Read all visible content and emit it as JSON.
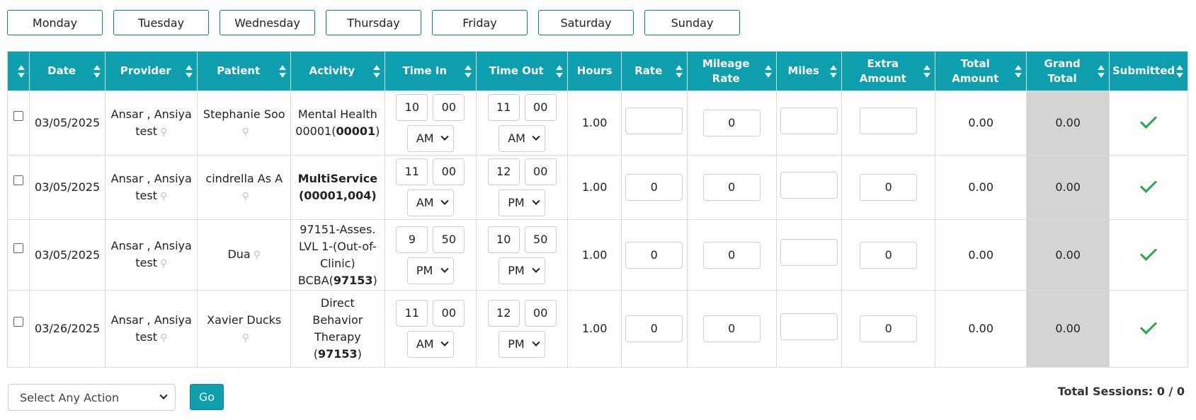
{
  "days": [
    "Monday",
    "Tuesday",
    "Wednesday",
    "Thursday",
    "Friday",
    "Saturday",
    "Sunday"
  ],
  "columns": {
    "date": "Date",
    "provider": "Provider",
    "patient": "Patient",
    "activity": "Activity",
    "time_in": "Time In",
    "time_out": "Time Out",
    "hours": "Hours",
    "rate": "Rate",
    "mileage_rate_1": "Mileage",
    "mileage_rate_2": "Rate",
    "miles": "Miles",
    "extra_amount_1": "Extra",
    "extra_amount_2": "Amount",
    "total_amount_1": "Total",
    "total_amount_2": "Amount",
    "grand_total_1": "Grand",
    "grand_total_2": "Total",
    "submitted": "Submitted"
  },
  "rows": [
    {
      "date": "03/05/2025",
      "provider_1": "Ansar , Ansiya",
      "provider_2": "test",
      "patient": "Stephanie Soo",
      "activity_1": "Mental Health",
      "activity_2": "00001(",
      "activity_code": "00001",
      "activity_3": ")",
      "time_in_hour": "10",
      "time_in_min": "00",
      "time_in_ampm": "AM",
      "time_out_hour": "11",
      "time_out_min": "00",
      "time_out_ampm": "AM",
      "hours": "1.00",
      "rate": "",
      "mileage_rate": "0",
      "miles": "",
      "extra_amount": "",
      "total_amount": "0.00",
      "grand_total": "0.00"
    },
    {
      "date": "03/05/2025",
      "provider_1": "Ansar , Ansiya",
      "provider_2": "test",
      "patient": "cindrella As A",
      "activity_1": "MultiService",
      "activity_2": "(00001,004)",
      "time_in_hour": "11",
      "time_in_min": "00",
      "time_in_ampm": "AM",
      "time_out_hour": "12",
      "time_out_min": "00",
      "time_out_ampm": "PM",
      "hours": "1.00",
      "rate": "0",
      "mileage_rate": "0",
      "miles": "",
      "extra_amount": "0",
      "total_amount": "0.00",
      "grand_total": "0.00"
    },
    {
      "date": "03/05/2025",
      "provider_1": "Ansar , Ansiya",
      "provider_2": "test",
      "patient": "Dua",
      "activity_1": "97151-Asses.",
      "activity_2": "LVL 1-(Out-of-",
      "activity_3": "Clinic)",
      "activity_4": "BCBA(",
      "activity_code": "97153",
      "activity_5": ")",
      "time_in_hour": "9",
      "time_in_min": "50",
      "time_in_ampm": "PM",
      "time_out_hour": "10",
      "time_out_min": "50",
      "time_out_ampm": "PM",
      "hours": "1.00",
      "rate": "0",
      "mileage_rate": "0",
      "miles": "",
      "extra_amount": "0",
      "total_amount": "0.00",
      "grand_total": "0.00"
    },
    {
      "date": "03/26/2025",
      "provider_1": "Ansar , Ansiya",
      "provider_2": "test",
      "patient": "Xavier Ducks",
      "activity_1": "Direct",
      "activity_2": "Behavior",
      "activity_3": "Therapy",
      "activity_4": "(",
      "activity_code": "97153",
      "activity_5": ")",
      "time_in_hour": "11",
      "time_in_min": "00",
      "time_in_ampm": "AM",
      "time_out_hour": "12",
      "time_out_min": "00",
      "time_out_ampm": "PM",
      "hours": "1.00",
      "rate": "0",
      "mileage_rate": "0",
      "miles": "",
      "extra_amount": "0",
      "total_amount": "0.00",
      "grand_total": "0.00"
    }
  ],
  "footer": {
    "action_select": "Select Any Action",
    "go": "Go",
    "total_sessions": "Total Sessions: 0 / 0"
  },
  "colors": {
    "header_bg": "#0d9fae",
    "grand_total_bg": "#d6d3d3",
    "submitted_check": "#28a745"
  }
}
